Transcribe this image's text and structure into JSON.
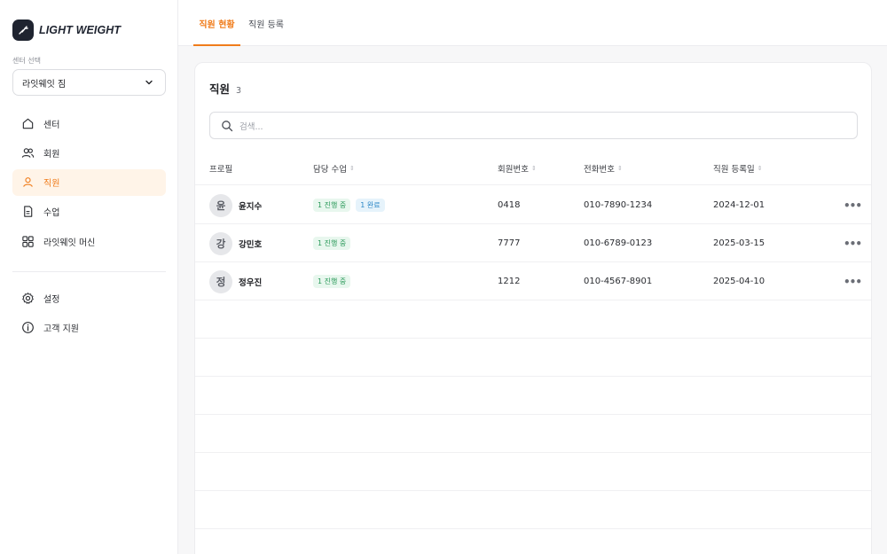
{
  "app": {
    "logo_text": "LIGHT WEIGHT"
  },
  "sidebar": {
    "center_label": "센터 선택",
    "center_value": "라잇웨잇 짐",
    "items": [
      {
        "label": "센터",
        "icon": "home-icon"
      },
      {
        "label": "회원",
        "icon": "users-icon"
      },
      {
        "label": "직원",
        "icon": "user-icon",
        "active": true
      },
      {
        "label": "수업",
        "icon": "document-icon"
      },
      {
        "label": "라잇웨잇 머신",
        "icon": "grid-icon"
      }
    ],
    "bottom_items": [
      {
        "label": "설정",
        "icon": "gear-icon"
      },
      {
        "label": "고객 지원",
        "icon": "info-icon"
      }
    ]
  },
  "tabs": [
    {
      "label": "직원 현황",
      "active": true
    },
    {
      "label": "직원 등록",
      "active": false
    }
  ],
  "main": {
    "title": "직원",
    "count": "3",
    "search_placeholder": "검색...",
    "columns": {
      "profile": "프로필",
      "classes": "담당 수업",
      "member_no": "회원번호",
      "phone": "전화번호",
      "registered": "직원 등록일"
    },
    "rows": [
      {
        "avatar": "윤",
        "name": "윤지수",
        "badges": [
          "1 진행 중",
          "1 완료"
        ],
        "member_no": "0418",
        "phone": "010-7890-1234",
        "registered": "2024-12-01",
        "more": "•••"
      },
      {
        "avatar": "강",
        "name": "강민호",
        "badges": [
          "1 진행 중"
        ],
        "member_no": "7777",
        "phone": "010-6789-0123",
        "registered": "2025-03-15",
        "more": "•••"
      },
      {
        "avatar": "정",
        "name": "정우진",
        "badges": [
          "1 진행 중"
        ],
        "member_no": "1212",
        "phone": "010-4567-8901",
        "registered": "2025-04-10",
        "more": "•••"
      }
    ]
  },
  "colors": {
    "accent": "#f07c1b",
    "badge_green": "#2b9a5a",
    "badge_blue": "#2a86c6"
  }
}
